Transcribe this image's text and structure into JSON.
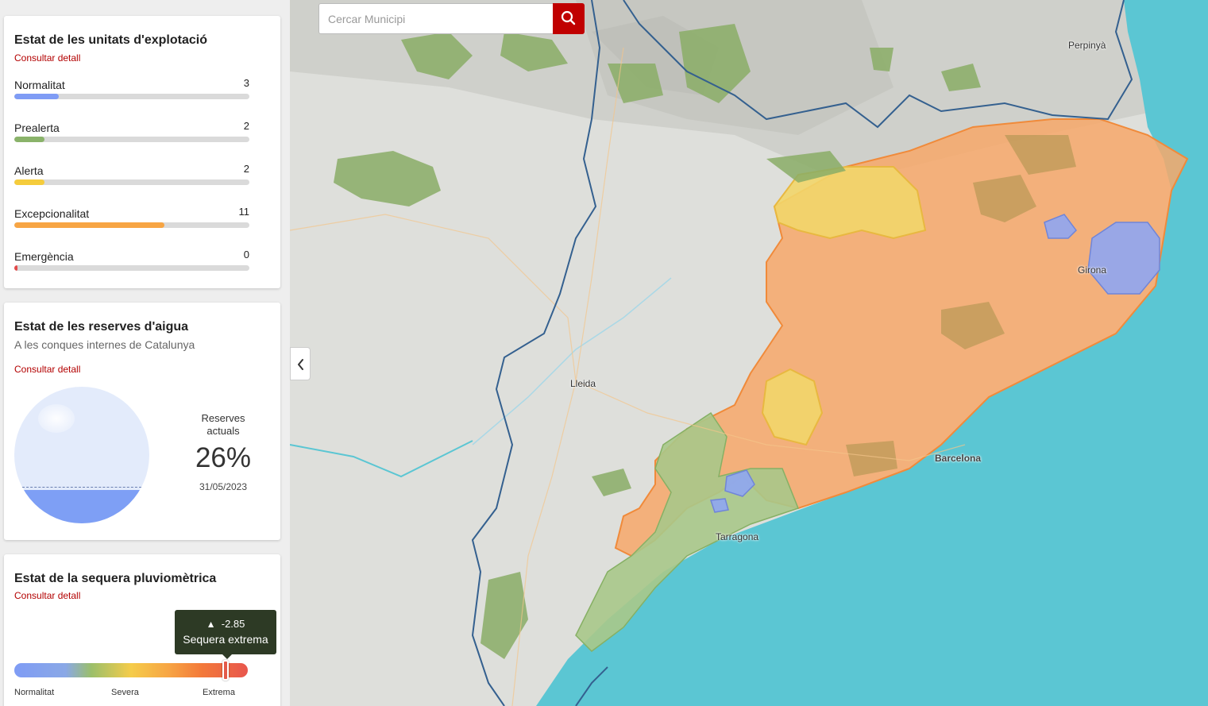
{
  "units": {
    "title": "Estat de les unitats d'explotació",
    "link": "Consultar detall",
    "items": [
      {
        "label": "Normalitat",
        "count": "3",
        "fraction": 0.1875,
        "color": "#7f9cf5"
      },
      {
        "label": "Prealerta",
        "count": "2",
        "fraction": 0.13,
        "color": "#8ab36a"
      },
      {
        "label": "Alerta",
        "count": "2",
        "fraction": 0.13,
        "color": "#f5cc3c"
      },
      {
        "label": "Excepcionalitat",
        "count": "11",
        "fraction": 0.64,
        "color": "#f7a544"
      },
      {
        "label": "Emergència",
        "count": "0",
        "fraction": 0.015,
        "color": "#e34a4a"
      }
    ]
  },
  "reserves": {
    "title": "Estat de les reserves d'aigua",
    "subtitle": "A les conques internes de Catalunya",
    "link": "Consultar detall",
    "label": "Reserves actuals",
    "value": "26%",
    "date": "31/05/2023"
  },
  "drought": {
    "title": "Estat de la sequera pluviomètrica",
    "link": "Consultar detall",
    "value": "-2.85",
    "state": "Sequera extrema",
    "scale_labels": [
      "Normalitat",
      "Severa",
      "Extrema"
    ],
    "marker_fraction": 0.905
  },
  "map": {
    "search_placeholder": "Cercar Municipi",
    "cities": [
      "Perpinyà",
      "Girona",
      "Lleida",
      "Barcelona",
      "Tarragona"
    ],
    "colors": {
      "sea": "#5bc6d3",
      "land": "#dedfdb",
      "orange": "#f7a86a",
      "yellow": "#f2d66a",
      "green": "#9cc47a",
      "blue": "#8fa6f2",
      "border": "#34608f",
      "accent": "#c00000"
    }
  }
}
